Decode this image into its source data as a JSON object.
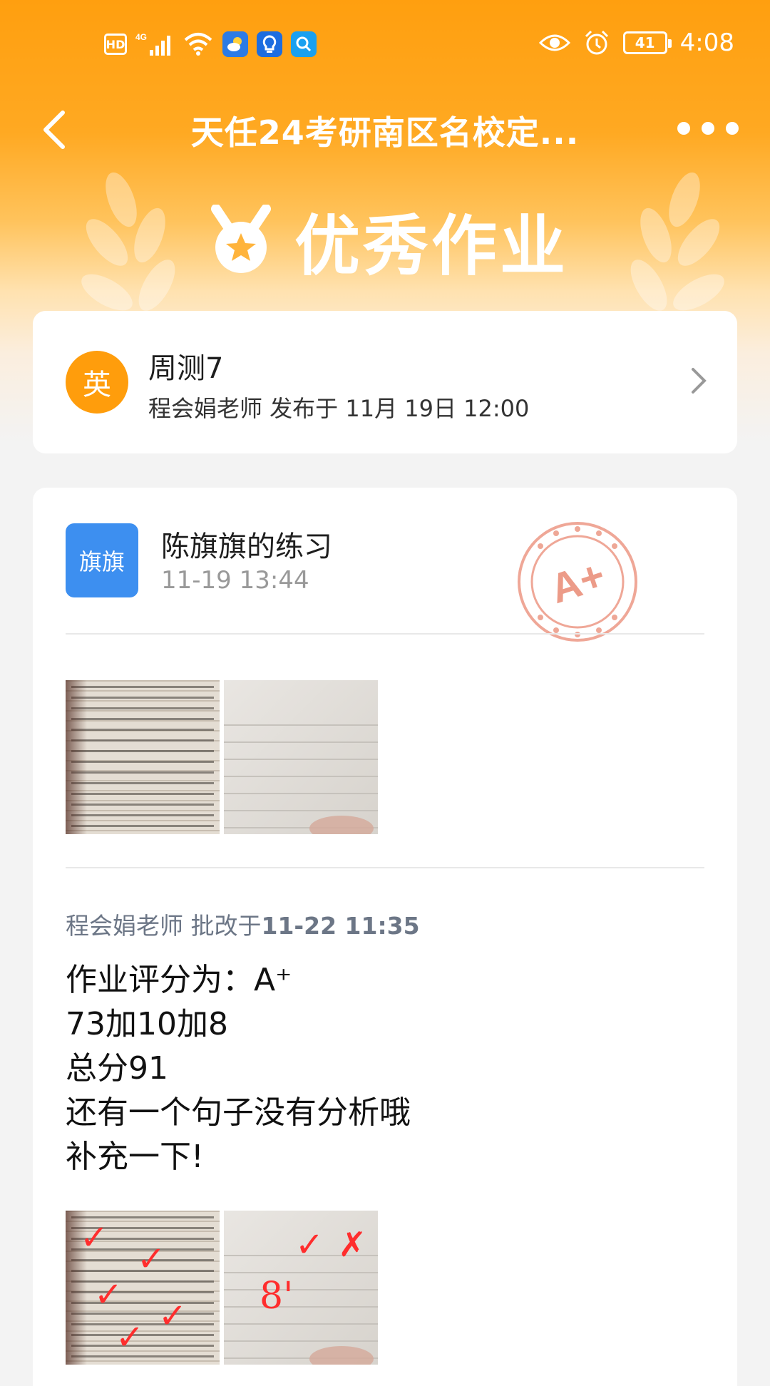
{
  "status_bar": {
    "hd": "HD",
    "network": "4G",
    "battery": "41",
    "time": "4:08"
  },
  "nav": {
    "title": "天任24考研南区名校定..."
  },
  "banner": {
    "title": "优秀作业"
  },
  "homework": {
    "avatar_text": "英",
    "title": "周测7",
    "meta": "程会娟老师 发布于 11月 19日 12:00"
  },
  "submission": {
    "avatar_text": "旗旗",
    "name": "陈旗旗的练习",
    "time": "11-19 13:44",
    "stamp_grade": "A+",
    "grader_name": "程会娟老师",
    "grader_action": "批改于",
    "grader_time": "11-22 11:35",
    "comment_lines": [
      "作业评分为：A⁺",
      "73加10加8",
      "总分91",
      "还有一个句子没有分析哦",
      "补充一下!"
    ],
    "corrected_mark": "8'"
  },
  "colors": {
    "brand_orange": "#ff9f0f",
    "avatar_blue": "#3d8ff0",
    "stamp_red": "#e98a74"
  },
  "icons": [
    "back-arrow-icon",
    "more-dots-icon",
    "medal-icon",
    "chevron-right-icon",
    "grade-stamp-icon",
    "wheat-icon",
    "eye-icon",
    "alarm-icon",
    "wifi-icon",
    "signal-icon"
  ]
}
